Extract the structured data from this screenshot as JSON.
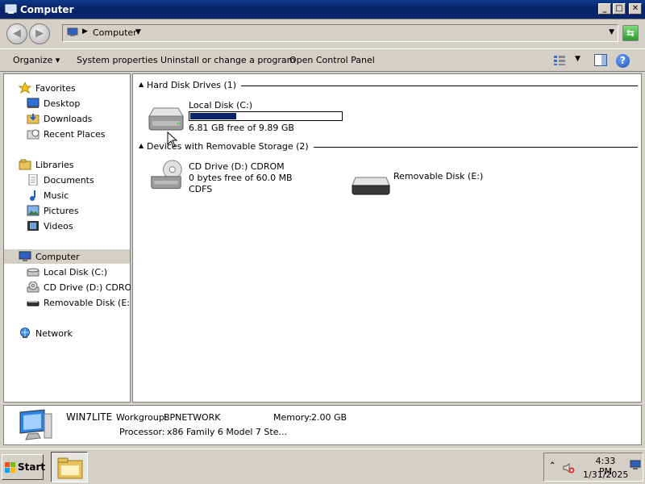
{
  "window": {
    "title": "Computer"
  },
  "address": {
    "path": "Computer"
  },
  "command_bar": {
    "items": [
      "Organize",
      "System properties",
      "Uninstall or change a program",
      "Open Control Panel"
    ]
  },
  "sidebar": {
    "favorites": "Favorites",
    "desktop": "Desktop",
    "downloads": "Downloads",
    "recent_places": "Recent Places",
    "libraries": "Libraries",
    "documents": "Documents",
    "music": "Music",
    "pictures": "Pictures",
    "videos": "Videos",
    "computer": "Computer",
    "local_disk": "Local Disk (C:)",
    "cd_drive": "CD Drive (D:) CDROM",
    "removable": "Removable Disk (E:)",
    "network": "Network"
  },
  "groups": {
    "hdd": "Hard Disk Drives (1)",
    "removable": "Devices with Removable Storage (2)"
  },
  "drives": {
    "c": {
      "name": "Local Disk (C:)",
      "free_text": "6.81 GB free of 9.89 GB",
      "used_fraction": 0.311
    },
    "d": {
      "name": "CD Drive (D:) CDROM",
      "free_text": "0 bytes free of 60.0 MB",
      "fs": "CDFS"
    },
    "e": {
      "name": "Removable Disk (E:)"
    }
  },
  "details": {
    "computer_name": "WIN7LITE",
    "workgroup_label": "Workgroup:",
    "workgroup": "BPNETWORK",
    "memory_label": "Memory:",
    "memory": "2.00 GB",
    "processor_label": "Processor:",
    "processor": "x86 Family 6 Model 7 Ste..."
  },
  "taskbar": {
    "start": "Start",
    "time": "4:33 PM",
    "date": "1/31/2025"
  }
}
